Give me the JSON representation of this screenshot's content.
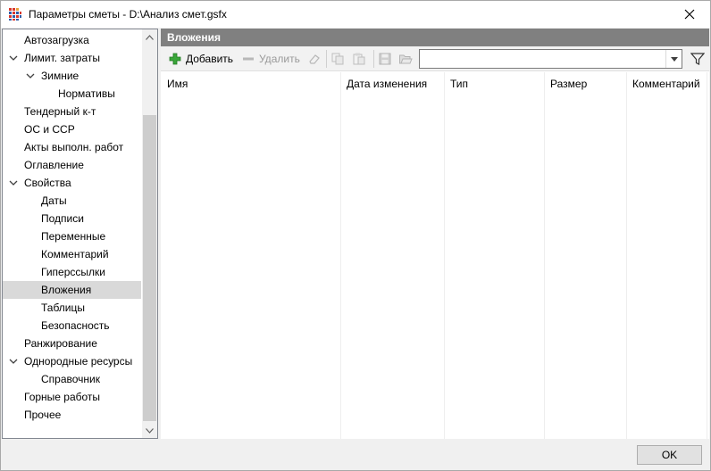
{
  "window": {
    "title": "Параметры сметы - D:\\Анализ смет.gsfx",
    "close_glyph": "✕"
  },
  "tree": {
    "items": [
      {
        "label": "Автозагрузка",
        "level": 0,
        "expander": false,
        "selected": false
      },
      {
        "label": "Лимит. затраты",
        "level": 0,
        "expander": true,
        "selected": false
      },
      {
        "label": "Зимние",
        "level": 1,
        "expander": true,
        "selected": false
      },
      {
        "label": "Нормативы",
        "level": 2,
        "expander": false,
        "selected": false
      },
      {
        "label": "Тендерный к-т",
        "level": 0,
        "expander": false,
        "selected": false
      },
      {
        "label": "ОС и ССР",
        "level": 0,
        "expander": false,
        "selected": false
      },
      {
        "label": "Акты выполн. работ",
        "level": 0,
        "expander": false,
        "selected": false
      },
      {
        "label": "Оглавление",
        "level": 0,
        "expander": false,
        "selected": false
      },
      {
        "label": "Свойства",
        "level": 0,
        "expander": true,
        "selected": false
      },
      {
        "label": "Даты",
        "level": 1,
        "expander": false,
        "selected": false
      },
      {
        "label": "Подписи",
        "level": 1,
        "expander": false,
        "selected": false
      },
      {
        "label": "Переменные",
        "level": 1,
        "expander": false,
        "selected": false
      },
      {
        "label": "Комментарий",
        "level": 1,
        "expander": false,
        "selected": false
      },
      {
        "label": "Гиперссылки",
        "level": 1,
        "expander": false,
        "selected": false
      },
      {
        "label": "Вложения",
        "level": 1,
        "expander": false,
        "selected": true
      },
      {
        "label": "Таблицы",
        "level": 1,
        "expander": false,
        "selected": false
      },
      {
        "label": "Безопасность",
        "level": 1,
        "expander": false,
        "selected": false
      },
      {
        "label": "Ранжирование",
        "level": 0,
        "expander": false,
        "selected": false
      },
      {
        "label": "Однородные ресурсы",
        "level": 0,
        "expander": true,
        "selected": false
      },
      {
        "label": "Справочник",
        "level": 1,
        "expander": false,
        "selected": false
      },
      {
        "label": "Горные работы",
        "level": 0,
        "expander": false,
        "selected": false
      },
      {
        "label": "Прочее",
        "level": 0,
        "expander": false,
        "selected": false
      }
    ]
  },
  "panel": {
    "header": "Вложения",
    "toolbar": {
      "add_label": "Добавить",
      "delete_label": "Удалить",
      "combo_value": ""
    },
    "columns": [
      "Имя",
      "Дата изменения",
      "Тип",
      "Размер",
      "Комментарий"
    ]
  },
  "footer": {
    "ok_label": "OK"
  },
  "colors": {
    "header_bg": "#808080",
    "selected_bg": "#d9d9d9",
    "add_icon": "#3aa63a",
    "app_icon_red": "#d9372b",
    "app_icon_blue": "#2f5da8"
  }
}
